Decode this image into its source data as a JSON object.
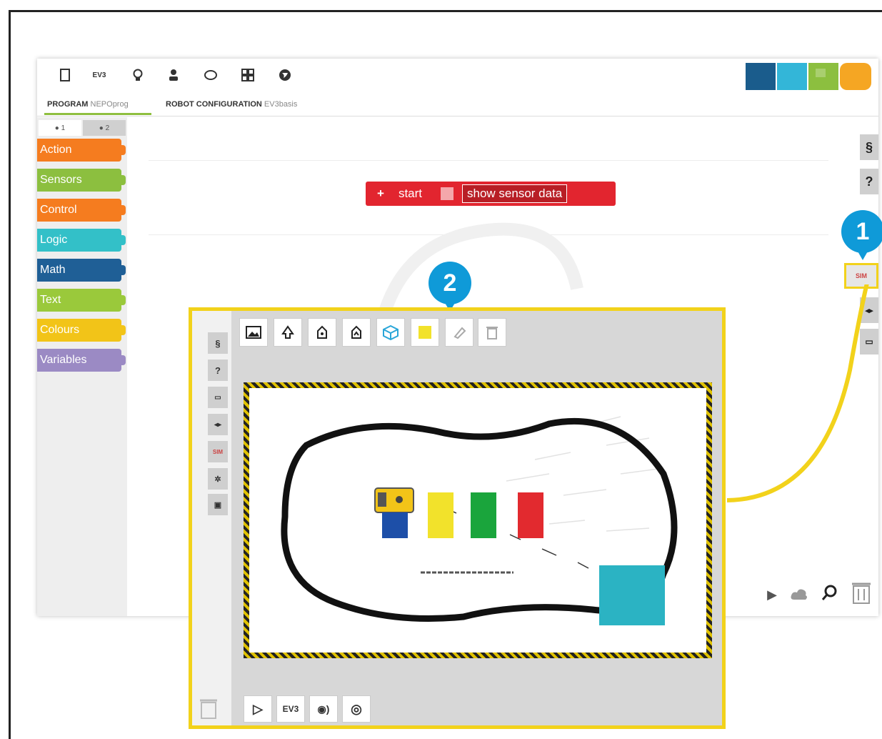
{
  "toolbar": {
    "icons": [
      "file-icon",
      "ev3-label",
      "bulb-icon",
      "user-icon",
      "robot-head-icon",
      "gallery-icon",
      "globe-icon"
    ],
    "ev3_label": "EV3"
  },
  "tabs": {
    "program_label": "PROGRAM",
    "program_name": "NEPOprog",
    "robot_label": "ROBOT CONFIGURATION",
    "robot_name": "EV3basis"
  },
  "levels": [
    "● 1",
    "● 2"
  ],
  "categories": [
    {
      "label": "Action",
      "color": "#f57c1f"
    },
    {
      "label": "Sensors",
      "color": "#8cbf3f"
    },
    {
      "label": "Control",
      "color": "#f57c1f"
    },
    {
      "label": "Logic",
      "color": "#33c0c8"
    },
    {
      "label": "Math",
      "color": "#1f5f96"
    },
    {
      "label": "Text",
      "color": "#9ac93b"
    },
    {
      "label": "Colours",
      "color": "#f2c418"
    },
    {
      "label": "Variables",
      "color": "#9b8ac4"
    }
  ],
  "start_block": {
    "plus": "+",
    "label": "start",
    "checkbox_label": "show sensor data"
  },
  "right_buttons": [
    "§",
    "?",
    "SIM",
    "◂▸",
    "▭"
  ],
  "badges": {
    "one": "1",
    "two": "2"
  },
  "zoom_side_buttons": [
    "§",
    "?",
    "▭",
    "◂▸",
    "SIM",
    "✲",
    "▣"
  ],
  "zoom_tools": [
    "image-icon",
    "export-icon",
    "import-icon",
    "upload-icon",
    "cube-icon",
    "color-icon",
    "eraser-icon",
    "trash-icon"
  ],
  "sim_controls": {
    "play": "▷",
    "ev3": "EV3",
    "sound": "◉)",
    "settings": "◎"
  },
  "colors": {
    "yellow": "#f2d21b",
    "green": "#1aa53c",
    "red": "#e22a2f",
    "blue": "#1d4fa8",
    "cyan": "#2bb3c3",
    "badge": "#0f9ad8"
  }
}
